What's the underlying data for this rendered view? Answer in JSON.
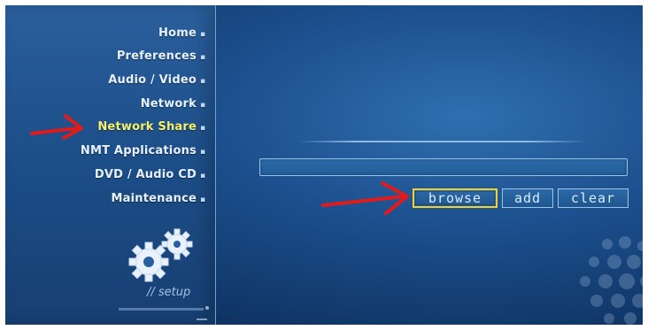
{
  "sidebar": {
    "items": [
      {
        "label": "Home"
      },
      {
        "label": "Preferences"
      },
      {
        "label": "Audio / Video"
      },
      {
        "label": "Network"
      },
      {
        "label": "Network Share"
      },
      {
        "label": "NMT Applications"
      },
      {
        "label": "DVD / Audio CD"
      },
      {
        "label": "Maintenance"
      }
    ],
    "selected_index": 4,
    "section_label": "// setup",
    "icon": "gears-icon"
  },
  "main": {
    "path_input": {
      "value": ""
    },
    "buttons": {
      "browse": "browse",
      "add": "add",
      "clear": "clear"
    },
    "focused_button": "browse"
  },
  "colors": {
    "background": "#1c4f8d",
    "menu_text": "#e7f2ff",
    "selected_text": "#f4f06a",
    "focus_border": "#f2d22a",
    "annotation_arrow": "#e01b1b"
  }
}
